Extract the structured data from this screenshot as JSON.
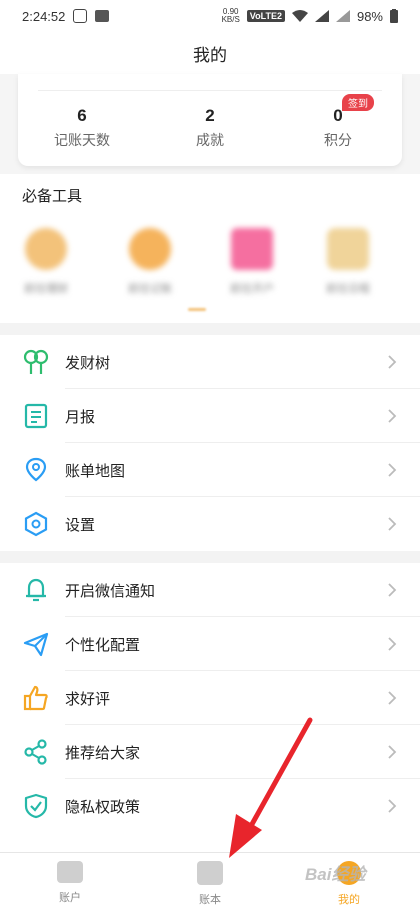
{
  "status_bar": {
    "time": "2:24:52",
    "net_speed": "0.90",
    "net_unit": "KB/S",
    "volte": "VoLTE2",
    "battery": "98%"
  },
  "header": {
    "title": "我的"
  },
  "stats": [
    {
      "value": "6",
      "label": "记账天数"
    },
    {
      "value": "2",
      "label": "成就"
    },
    {
      "value": "0",
      "label": "积分",
      "badge": "签到"
    }
  ],
  "tools": {
    "title": "必备工具",
    "items": [
      {
        "label": "前往理财",
        "color": "#f3c27a",
        "icon": "wallet-icon"
      },
      {
        "label": "前往记账",
        "color": "#f5b35c",
        "icon": "coin-icon"
      },
      {
        "label": "前往开户",
        "color": "#f56fa0",
        "icon": "factory-icon"
      },
      {
        "label": "前往日程",
        "color": "#f0d49a",
        "icon": "doc-icon"
      }
    ]
  },
  "menu_group1": [
    {
      "label": "发财树",
      "icon": "tree-icon",
      "color": "#2ebd6e"
    },
    {
      "label": "月报",
      "icon": "report-icon",
      "color": "#25b8a8"
    },
    {
      "label": "账单地图",
      "icon": "location-icon",
      "color": "#2a9df4"
    },
    {
      "label": "设置",
      "icon": "settings-icon",
      "color": "#2a9df4"
    }
  ],
  "menu_group2": [
    {
      "label": "开启微信通知",
      "icon": "bell-icon",
      "color": "#25b8a8"
    },
    {
      "label": "个性化配置",
      "icon": "paper-plane-icon",
      "color": "#2a9df4"
    },
    {
      "label": "求好评",
      "icon": "thumbs-up-icon",
      "color": "#f5a623"
    },
    {
      "label": "推荐给大家",
      "icon": "share-icon",
      "color": "#25b8a8"
    },
    {
      "label": "隐私权政策",
      "icon": "shield-check-icon",
      "color": "#25b8a8"
    }
  ],
  "bottom_nav": [
    {
      "label": "账户",
      "icon": "wallet-icon",
      "active": false
    },
    {
      "label": "账本",
      "icon": "ledger-icon",
      "active": false
    },
    {
      "label": "我的",
      "icon": "profile-icon",
      "active": true
    }
  ],
  "watermark": "Bai经验",
  "accent_colors": {
    "red": "#e8424a",
    "active_nav": "#f5a623"
  }
}
